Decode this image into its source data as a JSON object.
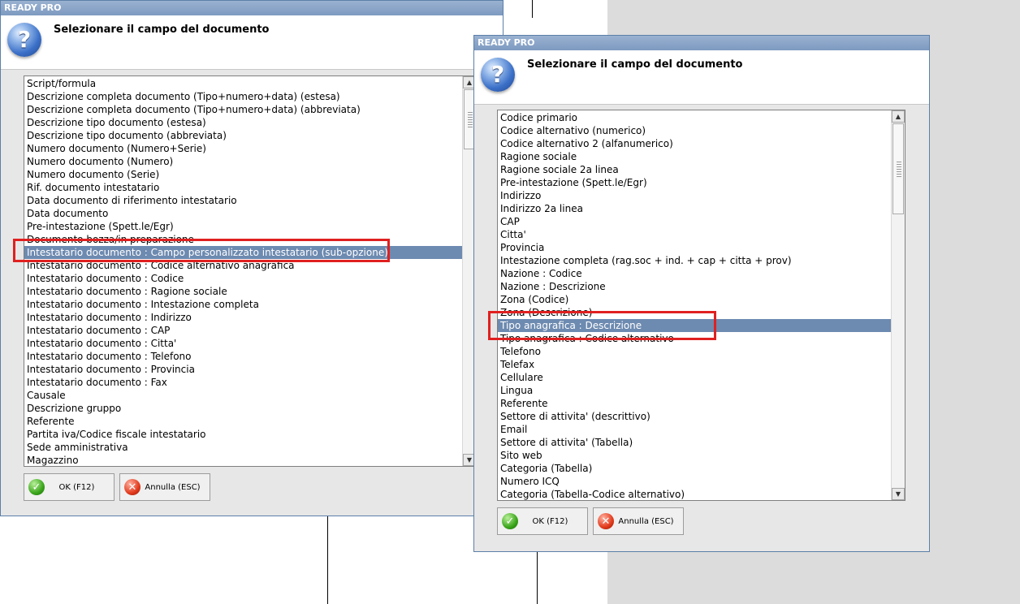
{
  "dialog1": {
    "app_title": "READY PRO",
    "heading": "Selezionare il campo del documento",
    "items": [
      "Script/formula",
      "Descrizione completa documento (Tipo+numero+data) (estesa)",
      "Descrizione completa documento (Tipo+numero+data) (abbreviata)",
      "Descrizione tipo documento (estesa)",
      "Descrizione tipo documento (abbreviata)",
      "Numero documento (Numero+Serie)",
      "Numero documento (Numero)",
      "Numero documento (Serie)",
      "Rif. documento intestatario",
      "Data documento di riferimento intestatario",
      "Data documento",
      "Pre-intestazione (Spett.le/Egr)",
      "Documento bozza/in preparazione",
      "Intestatario documento : Campo personalizzato intestatario (sub-opzione)",
      "Intestatario documento : Codice alternativo anagrafica",
      "Intestatario documento : Codice",
      "Intestatario documento : Ragione sociale",
      "Intestatario documento : Intestazione completa",
      "Intestatario documento : Indirizzo",
      "Intestatario documento : CAP",
      "Intestatario documento : Citta'",
      "Intestatario documento : Telefono",
      "Intestatario documento : Provincia",
      "Intestatario documento : Fax",
      "Causale",
      "Descrizione gruppo",
      "Referente",
      "Partita iva/Codice fiscale intestatario",
      "Sede amministrativa",
      "Magazzino"
    ],
    "selected_index": 13,
    "ok_label": "OK (F12)",
    "cancel_label": "Annulla (ESC)"
  },
  "dialog2": {
    "app_title": "READY PRO",
    "heading": "Selezionare il campo del documento",
    "items": [
      "Codice primario",
      "Codice alternativo (numerico)",
      "Codice alternativo 2 (alfanumerico)",
      "Ragione sociale",
      "Ragione sociale 2a linea",
      "Pre-intestazione (Spett.le/Egr)",
      "Indirizzo",
      "Indirizzo 2a linea",
      "CAP",
      "Citta'",
      "Provincia",
      "Intestazione completa (rag.soc + ind. + cap + citta + prov)",
      "Nazione : Codice",
      "Nazione : Descrizione",
      "Zona (Codice)",
      "Zona (Descrizione)",
      "Tipo anagrafica : Descrizione",
      "Tipo anagrafica : Codice alternativo",
      "Telefono",
      "Telefax",
      "Cellulare",
      "Lingua",
      "Referente",
      "Settore di attivita' (descrittivo)",
      "Email",
      "Settore di attivita' (Tabella)",
      "Sito web",
      "Categoria (Tabella)",
      "Numero ICQ",
      "Categoria (Tabella-Codice alternativo)"
    ],
    "selected_index": 16,
    "ok_label": "OK (F12)",
    "cancel_label": "Annulla (ESC)"
  },
  "icons": {
    "question": "question-icon",
    "ok": "check-icon",
    "cancel": "close-icon",
    "scroll_up": "scroll-up-arrow-icon",
    "scroll_down": "scroll-down-arrow-icon"
  },
  "colors": {
    "selection": "#6d8ab0",
    "highlight_box": "#e02020",
    "titlebar": "#8aa6cc"
  }
}
